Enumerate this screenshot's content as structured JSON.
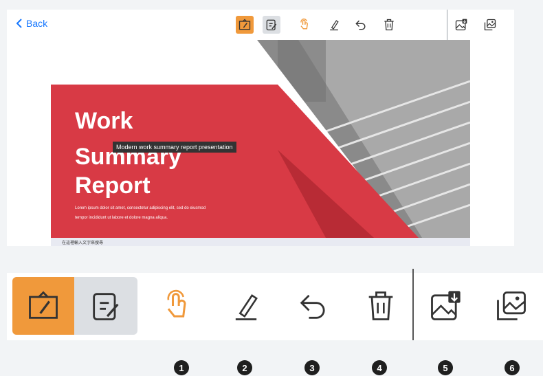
{
  "topbar": {
    "back_label": "Back"
  },
  "toolbar_icons": [
    "whiteboard-pen-icon",
    "note-edit-icon",
    "touch-hand-icon",
    "pen-icon",
    "undo-icon",
    "trash-icon",
    "save-image-icon",
    "gallery-icon"
  ],
  "slide": {
    "title_lines": [
      "Work",
      "Summary",
      "Report"
    ],
    "tooltip": "Modern work summary report presentation",
    "body_line1": "Lorem ipsum dolor sit amet, consectetur adipiscing elit, sed do eiusmod",
    "body_line2": "tempor incididunt ut labore et dolore magna aliqua.",
    "taskbar_search": "在這裡輸入文字來搜尋"
  },
  "badges": [
    "1",
    "2",
    "3",
    "4",
    "5",
    "6"
  ],
  "colors": {
    "accent": "#f0993b",
    "link": "#1677ff",
    "slide_red": "#d83a45",
    "selected_bg": "#dcdfe3"
  }
}
